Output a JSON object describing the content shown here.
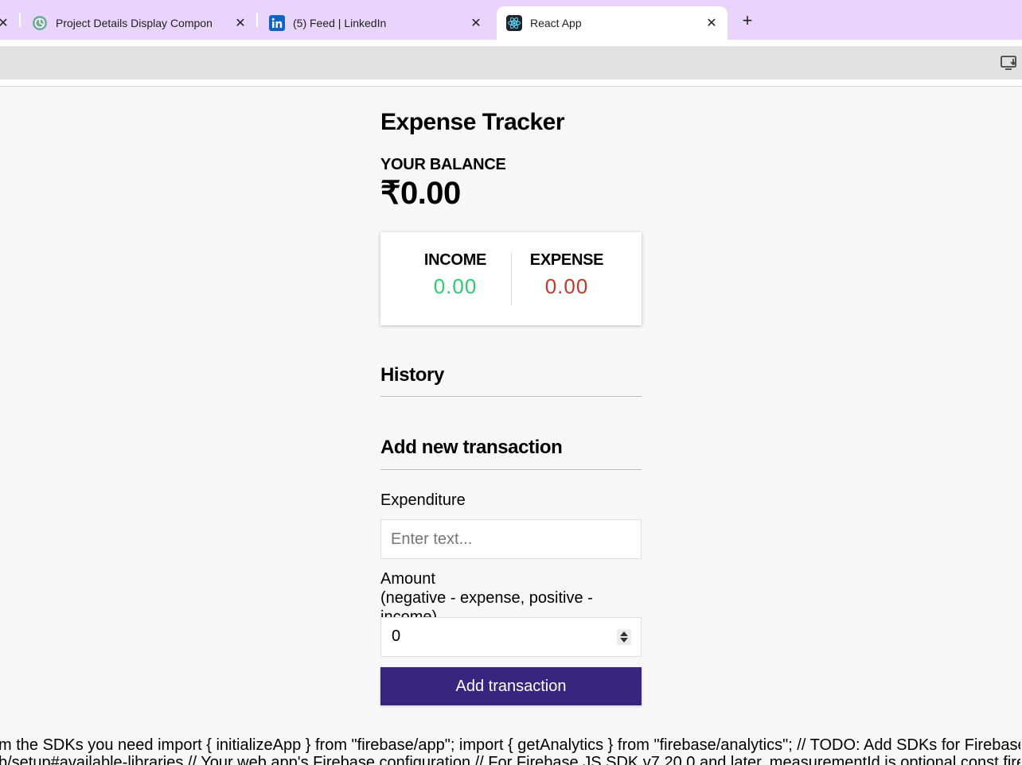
{
  "browser": {
    "tabs": [
      {
        "title": "Project Details Display Compon",
        "icon": "chatgpt-icon"
      },
      {
        "title": "(5) Feed | LinkedIn",
        "icon": "linkedin-icon"
      },
      {
        "title": "React App",
        "icon": "react-icon",
        "active": true
      }
    ],
    "close_glyph": "✕",
    "new_tab_glyph": "+"
  },
  "app": {
    "title": "Expense Tracker",
    "balance_label": "YOUR BALANCE",
    "balance_value": "₹0.00",
    "income_label": "INCOME",
    "income_value": "0.00",
    "expense_label": "EXPENSE",
    "expense_value": "0.00",
    "history_title": "History",
    "add_title": "Add new transaction",
    "text_label": "Expenditure",
    "text_placeholder": "Enter text...",
    "amount_label": "Amount",
    "amount_hint": "(negative - expense, positive - income)",
    "amount_value": "0",
    "submit_label": "Add transaction",
    "colors": {
      "income": "#2ecc71",
      "expense": "#c0392b",
      "button": "#372580"
    }
  },
  "page_text": {
    "line1": "m the SDKs you need import { initializeApp } from \"firebase/app\"; import { getAnalytics } from \"firebase/analytics\"; // TODO: Add SDKs for Firebase pro",
    "line2": "b/setup#available-libraries // Your web app's Firebase configuration // For Firebase JS SDK v7.20.0 and later, measurementId is optional const firebas"
  }
}
